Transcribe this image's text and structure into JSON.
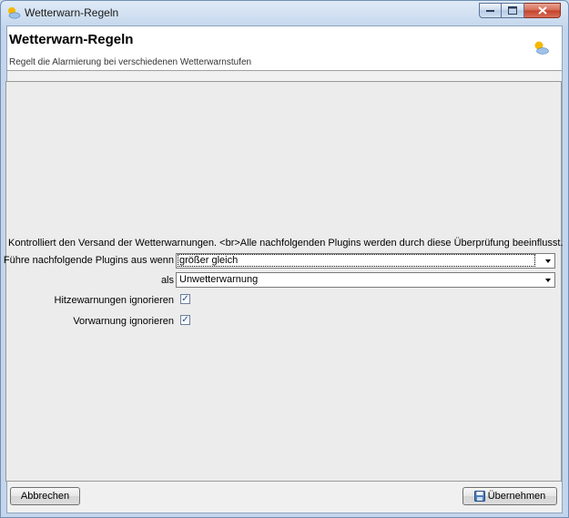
{
  "window": {
    "title": "Wetterwarn-Regeln",
    "controls": {
      "minimize": "minimize",
      "maximize": "maximize",
      "close": "close"
    }
  },
  "header": {
    "title": "Wetterwarn-Regeln",
    "subtitle": "Regelt die Alarmierung bei verschiedenen Wetterwarnstufen",
    "icon": "weather-sun-cloud-icon"
  },
  "form": {
    "description": "Kontrolliert den Versand der Wetterwarnungen. <br>Alle nachfolgenden Plugins werden durch diese Überprüfung beeinflusst.",
    "condition": {
      "label": "Führe nachfolgende Plugins aus wenn",
      "value": "größer gleich"
    },
    "level": {
      "label": "als",
      "value": "Unwetterwarnung"
    },
    "ignore_heat": {
      "label": "Hitzewarnungen ignorieren",
      "checked": true
    },
    "ignore_prewarning": {
      "label": "Vorwarnung ignorieren",
      "checked": true
    }
  },
  "footer": {
    "cancel_label": "Abbrechen",
    "apply_label": "Übernehmen"
  },
  "colors": {
    "accent": "#c4d6ec",
    "close_button": "#c2412a",
    "check": "#2a4e8a"
  }
}
